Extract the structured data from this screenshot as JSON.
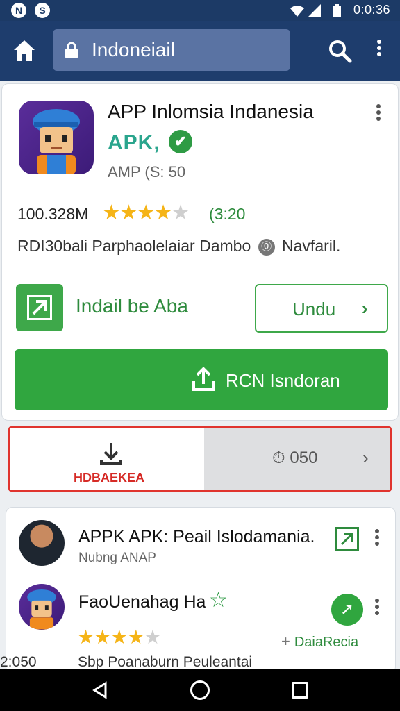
{
  "status_bar": {
    "time": "0:0:36",
    "left_icons": [
      "N",
      "S"
    ]
  },
  "app_bar": {
    "url_text": "Indoneiail",
    "icons": [
      "home-icon",
      "lock-icon",
      "search-icon",
      "more-vert-icon"
    ]
  },
  "app_card": {
    "title": "APP Inlomsia Indanesia",
    "apk_label": "APK,",
    "verified_symbol": "✔",
    "version": "AMP (S: 50",
    "downloads": "100.328M",
    "rating_stars": 4.5,
    "rating_count": "(3:20",
    "description_part1": "RDI30bali Parphaolelaiar Dambo",
    "description_icon": "⓪",
    "description_part2": "Navfaril.",
    "install_label": "Indail be Aba",
    "unduh_label": "Undu",
    "unduh_chevron": "›",
    "primary_button_label": "RCN Isndoran"
  },
  "download_bar": {
    "label": "HDBAEKEA",
    "timer": "⏱ 050",
    "chevron": "›"
  },
  "list": [
    {
      "title": "APPK APK: Peail Islodamania.",
      "subtitle": "Nubng ANAP"
    },
    {
      "title": "FaoUenahag Ha",
      "star_symbol": "☆",
      "rating_stars": 4,
      "badge_symbol": "➚",
      "link_plus": "+",
      "link_label": "DaiaRecia"
    }
  ],
  "bottom_row": {
    "time": "2:050",
    "text": "Sbp Poanaburn Peuleantai"
  },
  "colors": {
    "appbar": "#1e3d6d",
    "accent_green": "#30a63f",
    "star": "#f5b417",
    "alert_red": "#e0342e"
  }
}
